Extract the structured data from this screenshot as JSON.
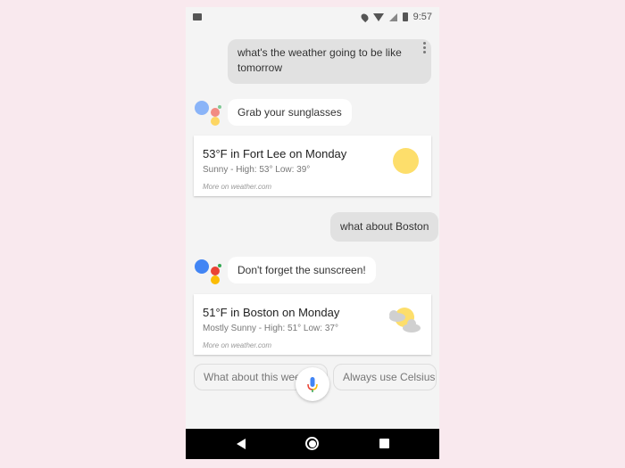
{
  "status_bar": {
    "time": "9:57",
    "icons": [
      "image-notification-icon",
      "location-icon",
      "wifi-icon",
      "no-signal-icon",
      "battery-icon"
    ]
  },
  "conversation": {
    "user_query_1": "what's the weather going to be like tomorrow",
    "assistant_reply_1": "Grab your sunglasses",
    "weather_card_1": {
      "title": "53°F in Fort Lee on Monday",
      "subtitle": "Sunny - High: 53° Low: 39°",
      "source": "More on weather.com",
      "icon": "sunny-icon"
    },
    "user_query_2": "what about Boston",
    "assistant_reply_2": "Don't forget the sunscreen!",
    "weather_card_2": {
      "title": "51°F in Boston on Monday",
      "subtitle": "Mostly Sunny - High: 51° Low: 37°",
      "source": "More on weather.com",
      "icon": "partly-cloudy-icon"
    }
  },
  "suggestions": [
    "What about this weekend",
    "Always use Celsius"
  ],
  "colors": {
    "google_blue": "#4285f4",
    "google_red": "#ea4335",
    "google_yellow": "#fbbc05",
    "google_green": "#34a853",
    "sun_yellow": "#fdde6b"
  }
}
